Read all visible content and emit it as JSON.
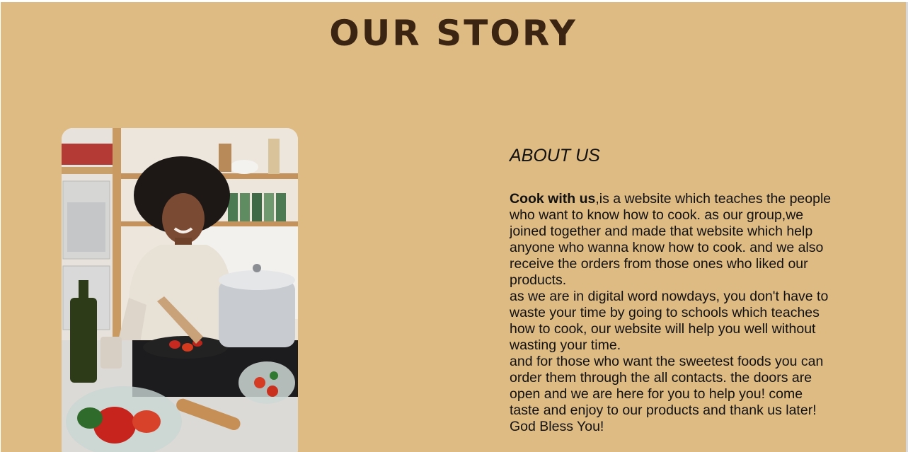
{
  "page": {
    "title": "OUR STORY",
    "background_color": "#dfbb84",
    "title_color": "#3b2412"
  },
  "photo": {
    "alt": "woman cooking in kitchen",
    "icon": "photo-image"
  },
  "about": {
    "heading": "ABOUT US",
    "brand": "Cook with us",
    "intro": ",is a website which teaches the people who want to know how to cook. as our group,we joined together and made that website which help anyone who wanna know how to cook. and we also receive the orders from those ones who liked our products.",
    "paragraph2": "as we are in digital word nowdays, you don't have to waste your time by going to schools which teaches how to cook, our website will help you well without wasting your time.",
    "paragraph3": "and for those who want the sweetest foods you can order them through the all contacts. the doors are open and we are here for you to help you! come taste and enjoy to our products and thank us later! God Bless You!"
  }
}
